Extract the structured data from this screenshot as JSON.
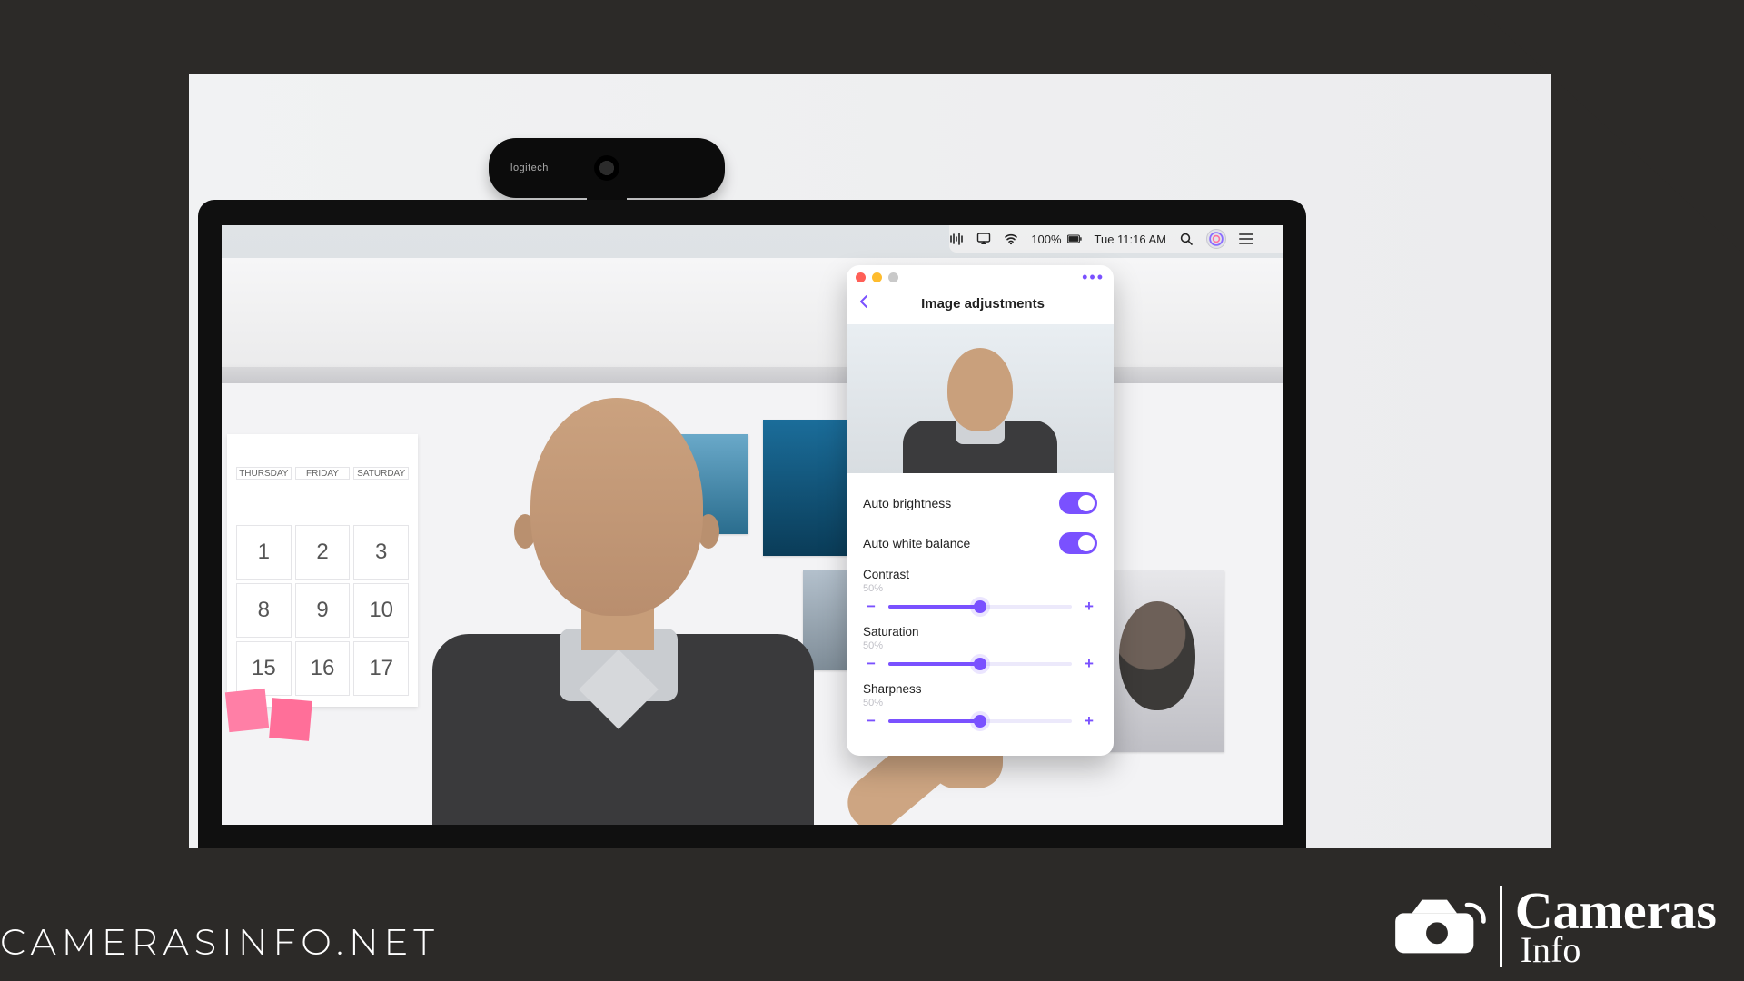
{
  "branding": {
    "footer_url": "CAMERASINFO.NET",
    "logo_line1": "Cameras",
    "logo_line2": "Info",
    "webcam_brand": "logitech"
  },
  "menubar": {
    "battery_percent": "100%",
    "clock": "Tue 11:16 AM"
  },
  "calendar": {
    "headers": [
      "THURSDAY",
      "FRIDAY",
      "SATURDAY"
    ],
    "cells": [
      "1",
      "2",
      "3",
      "8",
      "9",
      "10",
      "15",
      "16",
      "17"
    ]
  },
  "app": {
    "title": "Image adjustments",
    "more_label": "•••",
    "toggles": [
      {
        "label": "Auto brightness",
        "on": true
      },
      {
        "label": "Auto white balance",
        "on": true
      }
    ],
    "sliders": [
      {
        "name": "Contrast",
        "percent_label": "50%",
        "percent": 50
      },
      {
        "name": "Saturation",
        "percent_label": "50%",
        "percent": 50
      },
      {
        "name": "Sharpness",
        "percent_label": "50%",
        "percent": 50
      }
    ],
    "accent": "#7a51ff"
  }
}
